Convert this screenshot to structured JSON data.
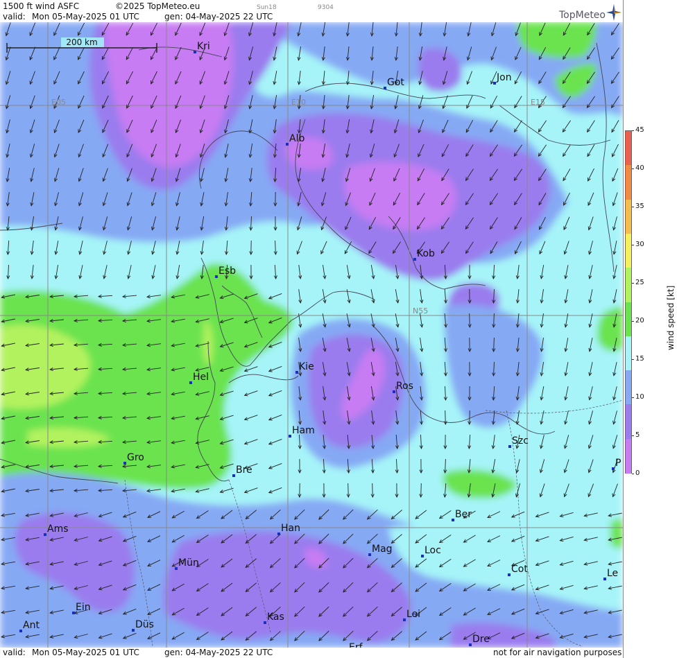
{
  "header": {
    "product": "1500 ft wind ASFC",
    "copyright": "©2025 TopMeteo.eu",
    "sun": "Sun18",
    "code": "9304",
    "valid_label": "valid:",
    "valid_time": "Mon  05-May-2025  01 UTC",
    "gen_time": "gen: 04-May-2025 22 UTC"
  },
  "footer": {
    "valid_label": "valid:",
    "valid_time": "Mon  05-May-2025  01 UTC",
    "gen_time": "gen: 04-May-2025 22 UTC",
    "disclaimer": "not for air navigation purposes"
  },
  "logo": {
    "text": "TopMeteo",
    "icon": "compass-star-icon"
  },
  "scale_bar": {
    "label": "200 km"
  },
  "grid_labels": {
    "e05": "E05",
    "e10": "E10",
    "e15": "E15",
    "n55": "N55"
  },
  "cities": [
    {
      "name": "Kri"
    },
    {
      "name": "Got"
    },
    {
      "name": "Jon"
    },
    {
      "name": "Alb"
    },
    {
      "name": "Kob"
    },
    {
      "name": "Esb"
    },
    {
      "name": "Kie"
    },
    {
      "name": "Hel"
    },
    {
      "name": "Ros"
    },
    {
      "name": "Ham"
    },
    {
      "name": "Szc"
    },
    {
      "name": "Gro"
    },
    {
      "name": "Bre"
    },
    {
      "name": "P"
    },
    {
      "name": "Ber"
    },
    {
      "name": "Ams"
    },
    {
      "name": "Han"
    },
    {
      "name": "Mag"
    },
    {
      "name": "Loc"
    },
    {
      "name": "Mün"
    },
    {
      "name": "Cot"
    },
    {
      "name": "Le"
    },
    {
      "name": "Ein"
    },
    {
      "name": "Kas"
    },
    {
      "name": "Lei"
    },
    {
      "name": "Ant"
    },
    {
      "name": "Düs"
    },
    {
      "name": "Dre"
    },
    {
      "name": "Erf"
    }
  ],
  "colorbar": {
    "ticks": [
      "0",
      "5",
      "10",
      "15",
      "20",
      "25",
      "30",
      "35",
      "40",
      "45"
    ],
    "units": "wind speed [kt]",
    "colors": [
      "#c77bf3",
      "#9a7cee",
      "#86a9f4",
      "#a6f4f8",
      "#6be34f",
      "#b3f25f",
      "#f5f05c",
      "#f5bd4c",
      "#f28a44",
      "#ea5f4e"
    ]
  },
  "wind": {
    "field_colors": {
      "c0": "#a6f4f8",
      "c1": "#86a9f4",
      "c2": "#9a7cee",
      "c3": "#c77bf3",
      "c4": "#6be34f",
      "c5": "#b3f25f"
    },
    "arrow_color": "#222222"
  }
}
